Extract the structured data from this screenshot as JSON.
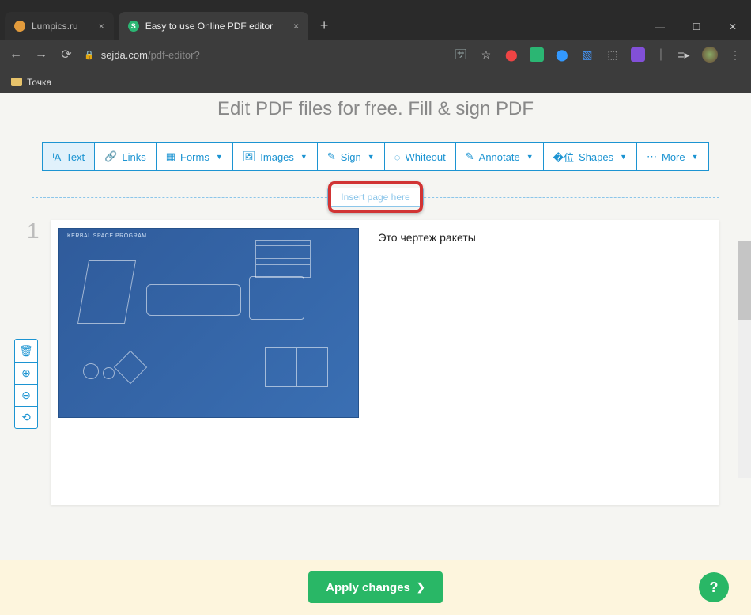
{
  "tabs": {
    "t0": {
      "label": "Lumpics.ru"
    },
    "t1": {
      "label": "Easy to use Online PDF editor"
    }
  },
  "url": {
    "host": "sejda.com",
    "path": "/pdf-editor?"
  },
  "bookmark": {
    "label": "Точка"
  },
  "header": {
    "title": "Edit PDF files for free. Fill & sign PDF"
  },
  "toolbar": {
    "text": "Text",
    "links": "Links",
    "forms": "Forms",
    "images": "Images",
    "sign": "Sign",
    "whiteout": "Whiteout",
    "annotate": "Annotate",
    "shapes": "Shapes",
    "more": "More"
  },
  "insert_chip": "Insert page here",
  "page_number": "1",
  "doc": {
    "blueprint_title": "KERBAL SPACE PROGRAM",
    "text_right": "Это чертеж ракеты"
  },
  "footer": {
    "apply": "Apply changes"
  }
}
